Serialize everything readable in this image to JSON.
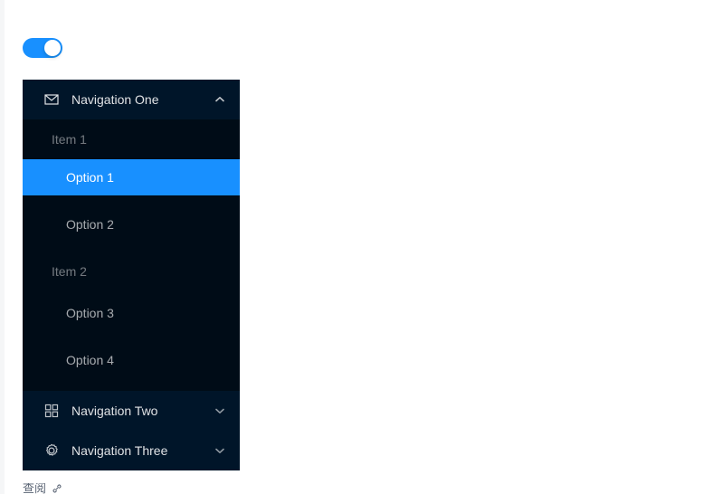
{
  "colors": {
    "accent": "#1890ff",
    "menu_bg": "#001529",
    "submenu_bg": "#000c17",
    "page_bg": "#ffffff"
  },
  "toggle": {
    "name": "collapse-toggle",
    "state": "on",
    "icon": "toggle-switch-on"
  },
  "menu": {
    "nav_one": {
      "label": "Navigation One",
      "icon": "mail-icon",
      "arrow_icon": "chevron-up-icon",
      "expanded": true,
      "groups": [
        {
          "title": "Item 1",
          "options": [
            {
              "label": "Option 1",
              "selected": true
            },
            {
              "label": "Option 2",
              "selected": false
            }
          ]
        },
        {
          "title": "Item 2",
          "options": [
            {
              "label": "Option 3",
              "selected": false
            },
            {
              "label": "Option 4",
              "selected": false
            }
          ]
        }
      ]
    },
    "nav_two": {
      "label": "Navigation Two",
      "icon": "appstore-grid-icon",
      "arrow_icon": "chevron-down-icon",
      "expanded": false
    },
    "nav_three": {
      "label": "Navigation Three",
      "icon": "gear-icon",
      "arrow_icon": "chevron-down-icon",
      "expanded": false
    }
  },
  "bottom_caption": {
    "text": "查阅",
    "icon": "link-icon"
  }
}
